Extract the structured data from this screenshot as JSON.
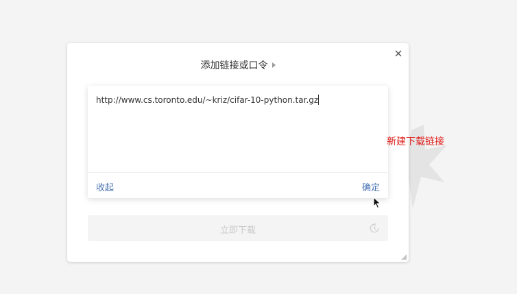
{
  "dialog": {
    "title": "添加链接或口令",
    "link_input": {
      "value": "http://www.cs.toronto.edu/~kriz/cifar-10-python.tar.gz"
    },
    "collapse_label": "收起",
    "confirm_label": "确定",
    "download_now_label": "立即下载"
  },
  "annotation": {
    "text": "新建下载链接",
    "color": "#e0231f"
  },
  "colors": {
    "link_blue": "#4a74b3",
    "background": "#f4f4f4",
    "disabled_text": "#c9c9c9"
  },
  "icons": {
    "close": "close-icon",
    "title_arrow": "caret-right-icon",
    "schedule": "clock-icon",
    "resize": "resize-grip-icon",
    "pointer": "mouse-cursor-icon"
  }
}
